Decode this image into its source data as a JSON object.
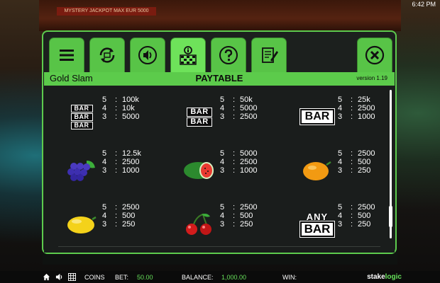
{
  "status": {
    "time": "6:42 PM"
  },
  "background": {
    "jackpot_banner": "MYSTERY JACKPOT MAX EUR 5000"
  },
  "menu": {
    "items": [
      {
        "name": "menu-button",
        "icon": "hamburger-icon"
      },
      {
        "name": "autoplay-button",
        "icon": "cycle-icon"
      },
      {
        "name": "sound-button",
        "icon": "speaker-icon"
      },
      {
        "name": "paytable-button",
        "icon": "info-grid-icon",
        "active": true
      },
      {
        "name": "help-button",
        "icon": "question-icon"
      },
      {
        "name": "history-button",
        "icon": "notepad-icon"
      },
      {
        "name": "close-button",
        "icon": "close-icon"
      }
    ]
  },
  "header": {
    "game_name": "Gold Slam",
    "title": "PAYTABLE",
    "version": "version 1.19"
  },
  "paytable": [
    {
      "symbol": "triple-bar",
      "label": "BAR",
      "pays": [
        [
          "5",
          "100k"
        ],
        [
          "4",
          "10k"
        ],
        [
          "3",
          "5000"
        ]
      ]
    },
    {
      "symbol": "double-bar",
      "label": "BAR",
      "pays": [
        [
          "5",
          "50k"
        ],
        [
          "4",
          "5000"
        ],
        [
          "3",
          "2500"
        ]
      ]
    },
    {
      "symbol": "single-bar",
      "label": "BAR",
      "pays": [
        [
          "5",
          "25k"
        ],
        [
          "4",
          "2500"
        ],
        [
          "3",
          "1000"
        ]
      ]
    },
    {
      "symbol": "grapes",
      "pays": [
        [
          "5",
          "12.5k"
        ],
        [
          "4",
          "2500"
        ],
        [
          "3",
          "1000"
        ]
      ]
    },
    {
      "symbol": "watermelon",
      "pays": [
        [
          "5",
          "5000"
        ],
        [
          "4",
          "2500"
        ],
        [
          "3",
          "1000"
        ]
      ]
    },
    {
      "symbol": "orange",
      "pays": [
        [
          "5",
          "2500"
        ],
        [
          "4",
          "500"
        ],
        [
          "3",
          "250"
        ]
      ]
    },
    {
      "symbol": "lemon",
      "pays": [
        [
          "5",
          "2500"
        ],
        [
          "4",
          "500"
        ],
        [
          "3",
          "250"
        ]
      ]
    },
    {
      "symbol": "cherries",
      "pays": [
        [
          "5",
          "2500"
        ],
        [
          "4",
          "500"
        ],
        [
          "3",
          "250"
        ]
      ]
    },
    {
      "symbol": "any-bar",
      "label_top": "ANY",
      "label": "BAR",
      "pays": [
        [
          "5",
          "2500"
        ],
        [
          "4",
          "500"
        ],
        [
          "3",
          "250"
        ]
      ]
    }
  ],
  "bottom_bar": {
    "coins_label": "COINS",
    "bet_label": "BET:",
    "bet_value": "50.00",
    "balance_label": "BALANCE:",
    "balance_value": "1,000.00",
    "win_label": "WIN:",
    "brand_a": "stake",
    "brand_b": "logic"
  },
  "colors": {
    "accent": "#5dcb4d",
    "panel": "#1c201e",
    "win_value": "#66e05a"
  }
}
